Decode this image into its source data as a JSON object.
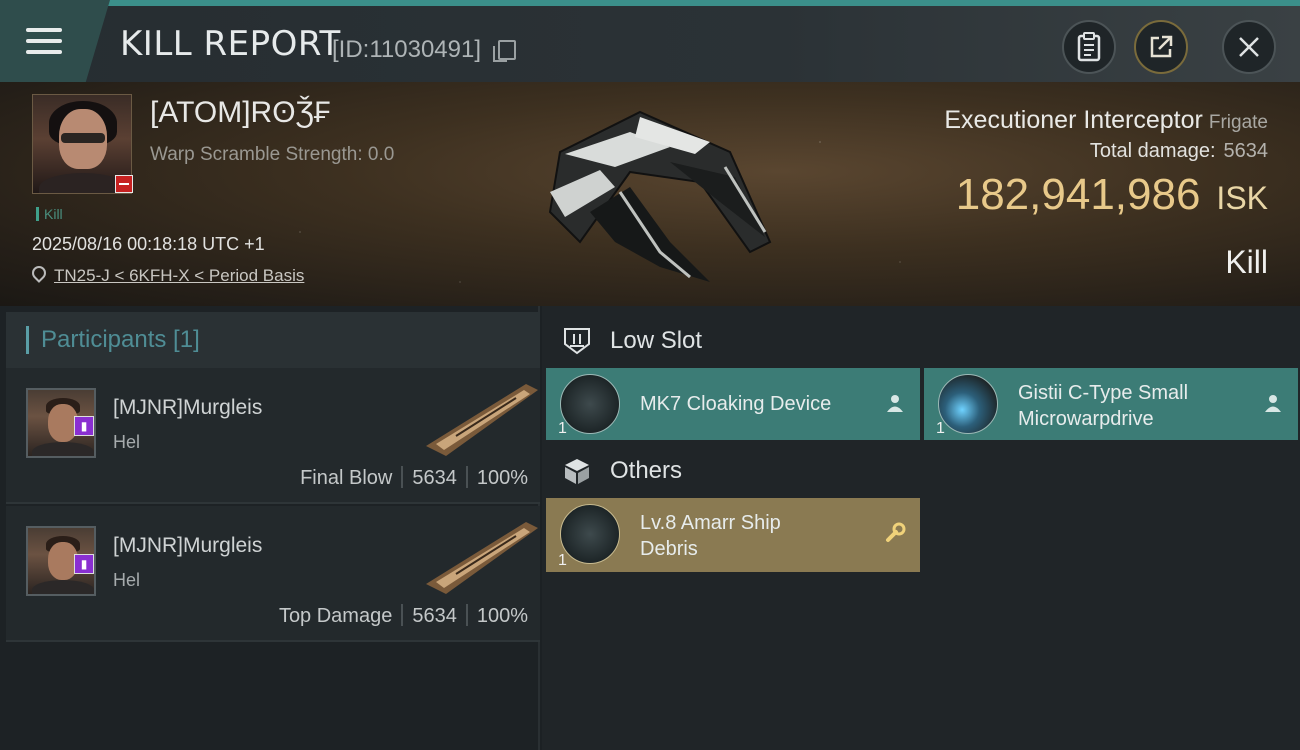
{
  "header": {
    "title": "KILL REPORT",
    "report_id": "[ID:11030491]"
  },
  "victim": {
    "name": "[ATOM]RʘǮ₣",
    "warp_scramble": "Warp Scramble Strength: 0.0",
    "tag": "Kill",
    "datetime": "2025/08/16 00:18:18 UTC +1",
    "location": "TN25-J < 6KFH-X < Period Basis",
    "ship_name": "Executioner Interceptor",
    "ship_class": "Frigate",
    "total_damage_label": "Total damage:",
    "total_damage": "5634",
    "isk_value": "182,941,986",
    "isk_unit": "ISK",
    "result": "Kill"
  },
  "participants": {
    "header": "Participants [1]",
    "rows": [
      {
        "name": "[MJNR]Murgleis",
        "ship": "Hel",
        "role": "Final Blow",
        "damage": "5634",
        "percent": "100%"
      },
      {
        "name": "[MJNR]Murgleis",
        "ship": "Hel",
        "role": "Top Damage",
        "damage": "5634",
        "percent": "100%"
      }
    ]
  },
  "loot": {
    "low_slot_label": "Low Slot",
    "others_label": "Others",
    "low_slot_items": [
      {
        "name_line1": "MK7 Cloaking Device",
        "name_line2": "",
        "qty": "1"
      },
      {
        "name_line1": "Gistii C-Type Small",
        "name_line2": "Microwarpdrive",
        "qty": "1"
      }
    ],
    "other_items": [
      {
        "name_line1": "Lv.8 Amarr Ship",
        "name_line2": "Debris",
        "qty": "1"
      }
    ]
  },
  "colors": {
    "accent_teal": "#3c7c76",
    "accent_gold": "#e8c98a",
    "debris_gold": "#8a7a52"
  }
}
